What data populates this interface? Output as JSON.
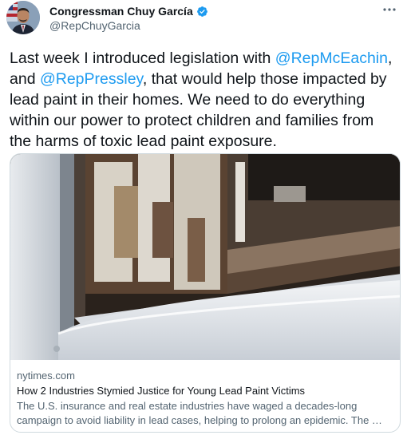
{
  "author": {
    "display_name": "Congressman Chuy García",
    "handle": "@RepChuyGarcia",
    "verified": true,
    "verified_icon": "verified-badge-icon",
    "avatar_icon": "profile-photo"
  },
  "more_icon": "more-horizontal-icon",
  "tweet": {
    "text_1": "Last week I introduced legislation with ",
    "mention_1": "@RepMcEachin",
    "text_2": ", and ",
    "mention_2": "@RepPressley",
    "text_3": ", that would help those impacted by lead paint in their homes. We need to do everything within our power to protect children and families from the harms of toxic lead paint exposure."
  },
  "link_card": {
    "image_icon": "peeling-lead-paint-window-photo",
    "domain": "nytimes.com",
    "title": "How 2 Industries Stymied Justice for Young Lead Paint Victims",
    "description": "The U.S. insurance and real estate industries have waged a decades-long campaign to avoid liability in lead cases, helping to prolong an epidemic. The …"
  },
  "colors": {
    "accent": "#1d9bf0",
    "text": "#0f1419",
    "secondary": "#536471",
    "border": "#cfd9de"
  }
}
